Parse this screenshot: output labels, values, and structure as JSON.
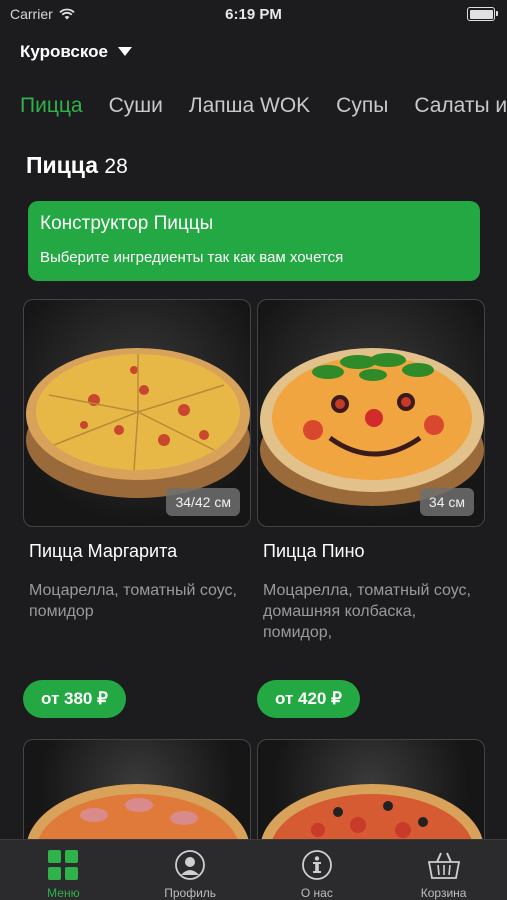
{
  "status": {
    "carrier": "Carrier",
    "time": "6:19 PM"
  },
  "location": {
    "city": "Куровское"
  },
  "categories": [
    "Пицца",
    "Суши",
    "Лапша WOK",
    "Супы",
    "Салаты и"
  ],
  "section": {
    "title": "Пицца",
    "count": "28"
  },
  "banner": {
    "title": "Конструктор Пиццы",
    "subtitle": "Выберите ингредиенты так как вам хочется"
  },
  "products": [
    {
      "name": "Пицца Маргарита",
      "description": "Моцарелла, томатный соус, помидор",
      "size": "34/42 см",
      "price": "от 380 ₽"
    },
    {
      "name": "Пицца Пино",
      "description": "Моцарелла, томатный соус, домашняя колбаска, помидор,",
      "size": "34 см",
      "price": "от 420 ₽"
    }
  ],
  "tabbar": {
    "menu": "Меню",
    "profile": "Профиль",
    "about": "О нас",
    "cart": "Корзина"
  },
  "colors": {
    "accent": "#23a843",
    "background": "#1c1c1e"
  }
}
